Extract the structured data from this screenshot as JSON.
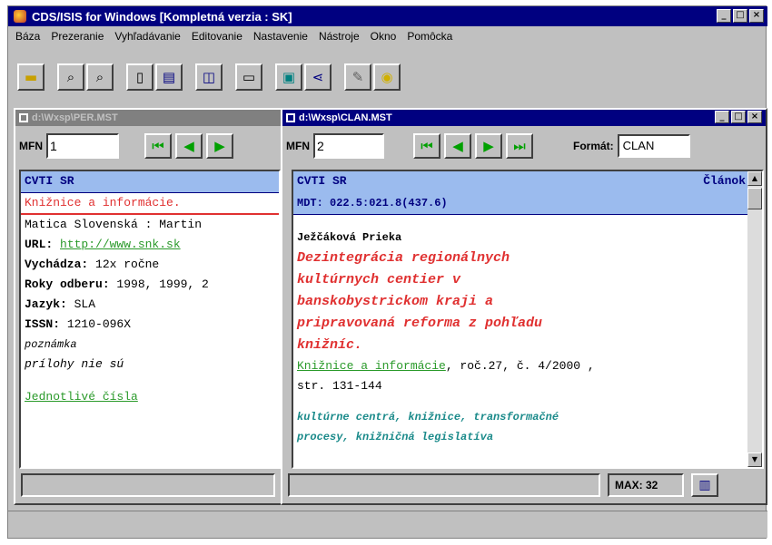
{
  "app": {
    "title": "CDS/ISIS for Windows [Kompletná verzia : SK]",
    "window_buttons": [
      "_",
      "□",
      "×"
    ]
  },
  "menu": [
    "Báza",
    "Prezeranie",
    "Vyhľadávanie",
    "Editovanie",
    "Nastavenie",
    "Nástroje",
    "Okno",
    "Pomôcka"
  ],
  "toolbar": {
    "icons": [
      "open-folder-icon",
      "search-icon",
      "search-icon",
      "clipboard-icon",
      "edit-record-icon",
      "preview-icon",
      "print-icon",
      "display-icon",
      "sort-icon",
      "pencil-icon",
      "bulb-icon"
    ]
  },
  "left_window": {
    "title": "d:\\Wxsp\\PER.MST",
    "mfn_label": "MFN",
    "mfn_value": "1",
    "header": "CVTI SR",
    "red_line": "Knižnice a informácie.",
    "lines": [
      {
        "text": "Matica Slovenská : Martin",
        "class": "",
        "label": ""
      },
      {
        "label": "URL: ",
        "text": "http://www.snk.sk",
        "class": "green"
      },
      {
        "label": "Vychádza: ",
        "text": "12x ročne",
        "class": ""
      },
      {
        "label": "Roky odberu: ",
        "text": "1998, 1999, 2",
        "class": ""
      },
      {
        "label": "Jazyk: ",
        "text": "SLA",
        "class": ""
      },
      {
        "label": "ISSN: ",
        "text": "1210-096X",
        "class": ""
      },
      {
        "label": "",
        "text": "poznámka",
        "class": "italic"
      },
      {
        "label": "",
        "text": "prílohy nie sú",
        "class": "italic"
      }
    ],
    "link": "Jednotlivé čísla"
  },
  "right_window": {
    "title": "d:\\Wxsp\\CLAN.MST",
    "mfn_label": "MFN",
    "mfn_value": "2",
    "format_label": "Formát:",
    "format_value": "CLAN",
    "header_left": "CVTI SR",
    "header_right": "Článok",
    "mdt": "MDT: 022.5:021.8(437.6)",
    "author": "Ježčáková Prieka",
    "title_lines": [
      "Dezintegrácia regionálnych",
      "kultúrnych centier v",
      "banskobystrickom kraji a",
      "pripravovaná reforma z pohľadu",
      "knižníc."
    ],
    "source_link": "Knižnice a informácie",
    "source_rest": ", roč.27, č. 4/2000 ,",
    "pages": "str. 131-144",
    "keywords": [
      "kultúrne centrá, knižnice, transformačné",
      "procesy, knižničná legislatíva"
    ],
    "max_label": "MAX: 32"
  }
}
